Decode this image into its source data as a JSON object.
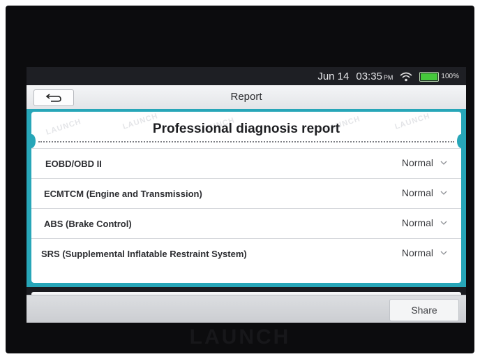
{
  "status_bar": {
    "date": "Jun 14",
    "time": "03:35",
    "ampm": "PM",
    "battery": "100%",
    "battery_level": 1.0,
    "wifi_icon": "wifi-icon"
  },
  "header": {
    "back_icon": "back-arrow-icon",
    "title": "Report"
  },
  "report": {
    "heading": "Professional diagnosis report",
    "watermark": "LAUNCH",
    "systems": [
      {
        "name": "EOBD/OBD II",
        "status": "Normal"
      },
      {
        "name": "ECMTCM (Engine and Transmission)",
        "status": "Normal"
      },
      {
        "name": "ABS (Brake Control)",
        "status": "Normal"
      },
      {
        "name": "SRS (Supplemental Inflatable Restraint System)",
        "status": "Normal"
      }
    ]
  },
  "footer": {
    "share_label": "Share"
  },
  "device": {
    "brand": "LAUNCH"
  },
  "colors": {
    "accent_teal": "#27a6b8",
    "battery_green": "#46c93c"
  }
}
